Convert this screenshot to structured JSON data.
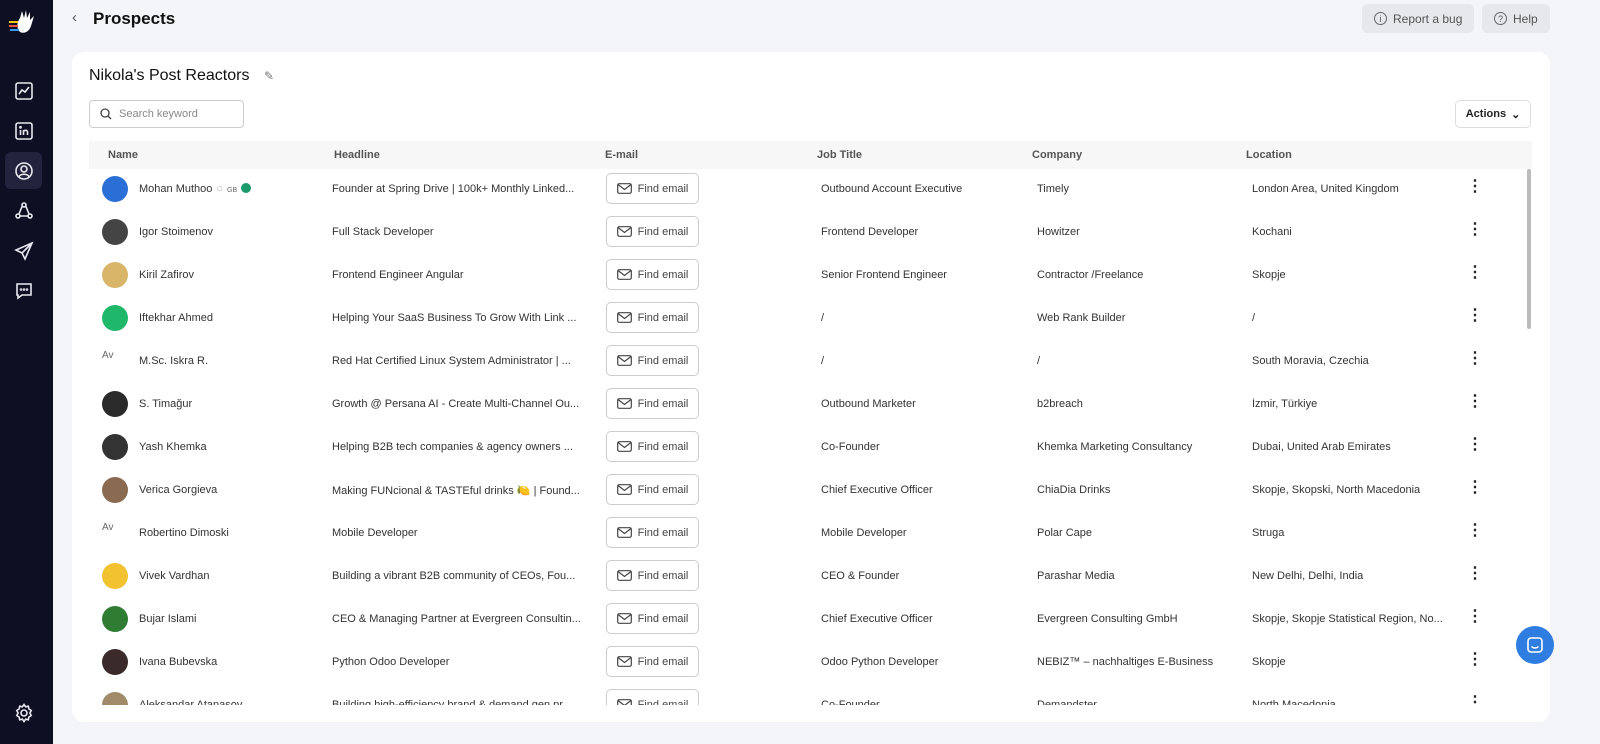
{
  "header": {
    "title": "Prospects",
    "report_bug": "Report a bug",
    "help": "Help"
  },
  "sidebar": {
    "items": [
      "analytics",
      "linkedin",
      "prospects",
      "network",
      "campaigns",
      "messages",
      "settings"
    ],
    "active": "prospects"
  },
  "list": {
    "title": "Nikola's Post Reactors",
    "search_placeholder": "Search keyword",
    "actions_label": "Actions"
  },
  "table": {
    "columns": [
      "Name",
      "Headline",
      "E-mail",
      "Job Title",
      "Company",
      "Location"
    ],
    "find_email_label": "Find email",
    "rows": [
      {
        "name": "Mohan Muthoo",
        "tag": "GB",
        "headline": "Founder at Spring Drive | 100k+ Monthly Linked...",
        "job": "Outbound Account Executive",
        "company": "Timely",
        "location": "London Area, United Kingdom",
        "avatar_color": "#2a6fd6"
      },
      {
        "name": "Igor Stoimenov",
        "headline": "Full Stack Developer",
        "job": "Frontend Developer",
        "company": "Howitzer",
        "location": "Kochani",
        "avatar_color": "#444"
      },
      {
        "name": "Kiril Zafirov",
        "headline": "Frontend Engineer Angular",
        "job": "Senior Frontend Engineer",
        "company": "Contractor /Freelance",
        "location": "Skopje",
        "avatar_color": "#d9b56a"
      },
      {
        "name": "Iftekhar Ahmed",
        "headline": "Helping Your SaaS Business To Grow With Link ...",
        "job": "/",
        "company": "Web Rank Builder",
        "location": "/",
        "avatar_color": "#1fb86a"
      },
      {
        "name": "M.Sc. Iskra R.",
        "avatar_alt": "Av",
        "headline": "Red Hat Certified Linux System Administrator | ...",
        "job": "/",
        "company": "/",
        "location": "South Moravia, Czechia",
        "avatar_color": ""
      },
      {
        "name": "S. Timağur",
        "headline": "Growth @ Persana AI - Create Multi-Channel Ou...",
        "job": "Outbound Marketer",
        "company": "b2breach",
        "location": "İzmir, Türkiye",
        "avatar_color": "#2a2a2a"
      },
      {
        "name": "Yash Khemka",
        "headline": "Helping B2B tech companies & agency owners ...",
        "job": "Co-Founder",
        "company": "Khemka Marketing Consultancy",
        "location": "Dubai, United Arab Emirates",
        "avatar_color": "#333"
      },
      {
        "name": "Verica Gorgieva",
        "headline": "Making FUNcional & TASTEful drinks 🍋 | Found...",
        "job": "Chief Executive Officer",
        "company": "ChiaDia Drinks",
        "location": "Skopje, Skopski, North Macedonia",
        "avatar_color": "#8a6a50"
      },
      {
        "name": "Robertino Dimoski",
        "avatar_alt": "Av",
        "headline": "Mobile Developer",
        "job": "Mobile Developer",
        "company": "Polar Cape",
        "location": "Struga",
        "avatar_color": ""
      },
      {
        "name": "Vivek Vardhan",
        "headline": "Building a vibrant B2B community of CEOs, Fou...",
        "job": "CEO & Founder",
        "company": "Parashar Media",
        "location": "New Delhi, Delhi, India",
        "avatar_color": "#f2c230"
      },
      {
        "name": "Bujar Islami",
        "headline": "CEO & Managing Partner at Evergreen Consultin...",
        "job": "Chief Executive Officer",
        "company": "Evergreen Consulting GmbH",
        "location": "Skopje, Skopje Statistical Region, No...",
        "avatar_color": "#2e7d32"
      },
      {
        "name": "Ivana Bubevska",
        "headline": "Python Odoo Developer",
        "job": "Odoo Python Developer",
        "company": "NEBIZ™ – nachhaltiges E-Business",
        "location": "Skopje",
        "avatar_color": "#3a2a2a"
      },
      {
        "name": "Aleksandar Atanasov",
        "headline": "Building high-efficiency brand & demand gen pr...",
        "job": "Co-Founder",
        "company": "Demandster",
        "location": "North Macedonia",
        "avatar_color": "#a08a6a"
      }
    ]
  }
}
